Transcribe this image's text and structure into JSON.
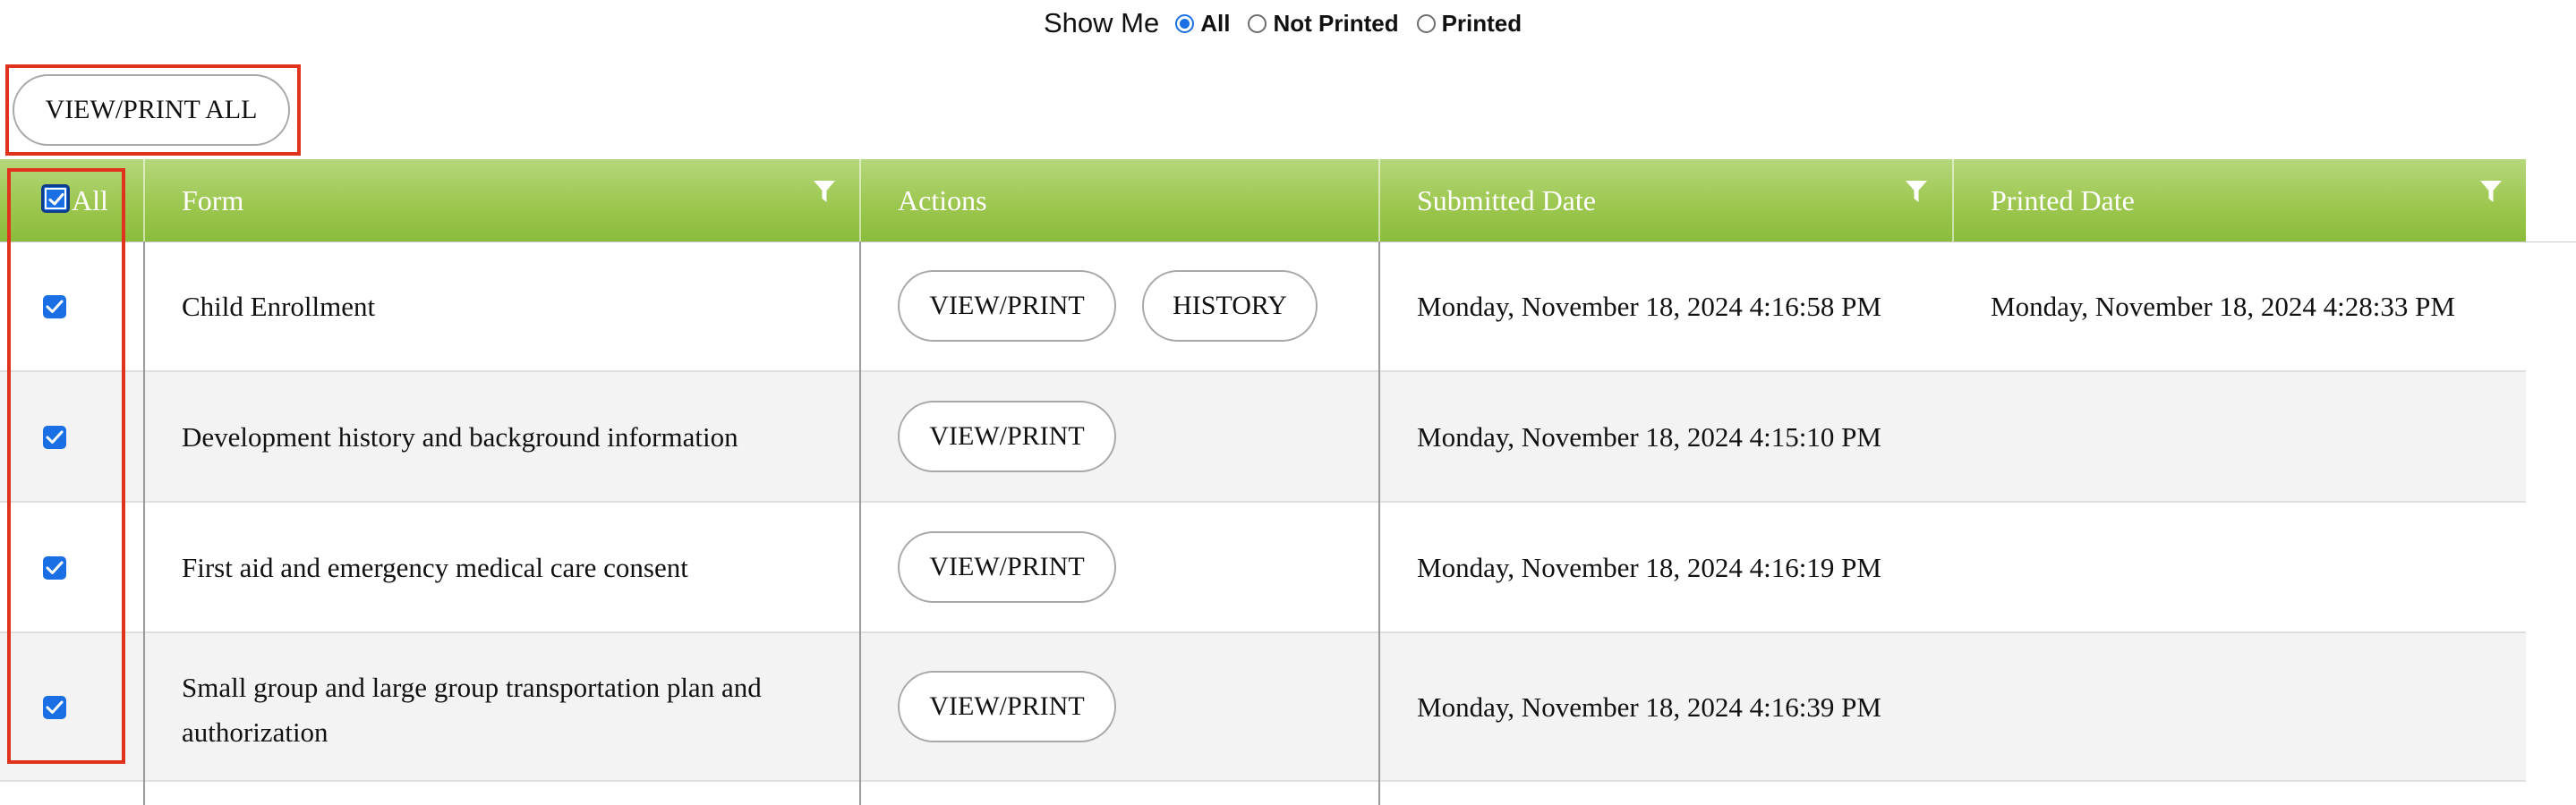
{
  "filter": {
    "label": "Show Me",
    "options": [
      {
        "label": "All",
        "selected": true
      },
      {
        "label": "Not Printed",
        "selected": false
      },
      {
        "label": "Printed",
        "selected": false
      }
    ]
  },
  "toolbar": {
    "view_print_all_label": "VIEW/PRINT ALL"
  },
  "table": {
    "columns": {
      "select_all": "All",
      "form": "Form",
      "actions": "Actions",
      "submitted": "Submitted Date",
      "printed": "Printed Date"
    },
    "header_color": "#9dc750",
    "rows": [
      {
        "checked": true,
        "form": "Child Enrollment",
        "actions": {
          "view_print": "VIEW/PRINT",
          "history": "HISTORY"
        },
        "submitted": "Monday, November 18, 2024 4:16:58 PM",
        "printed": "Monday, November 18, 2024 4:28:33 PM"
      },
      {
        "checked": true,
        "form": "Development history and background information",
        "actions": {
          "view_print": "VIEW/PRINT"
        },
        "submitted": "Monday, November 18, 2024 4:15:10 PM",
        "printed": ""
      },
      {
        "checked": true,
        "form": "First aid and emergency medical care consent",
        "actions": {
          "view_print": "VIEW/PRINT"
        },
        "submitted": "Monday, November 18, 2024 4:16:19 PM",
        "printed": ""
      },
      {
        "checked": true,
        "form": "Small group and large group transportation plan and authorization",
        "actions": {
          "view_print": "VIEW/PRINT"
        },
        "submitted": "Monday, November 18, 2024 4:16:39 PM",
        "printed": ""
      }
    ]
  },
  "icons": {
    "filter": "funnel-icon",
    "checkbox": "checkmark-icon"
  },
  "colors": {
    "accent": "#1a6fe4",
    "annotation": "#e0321c"
  }
}
